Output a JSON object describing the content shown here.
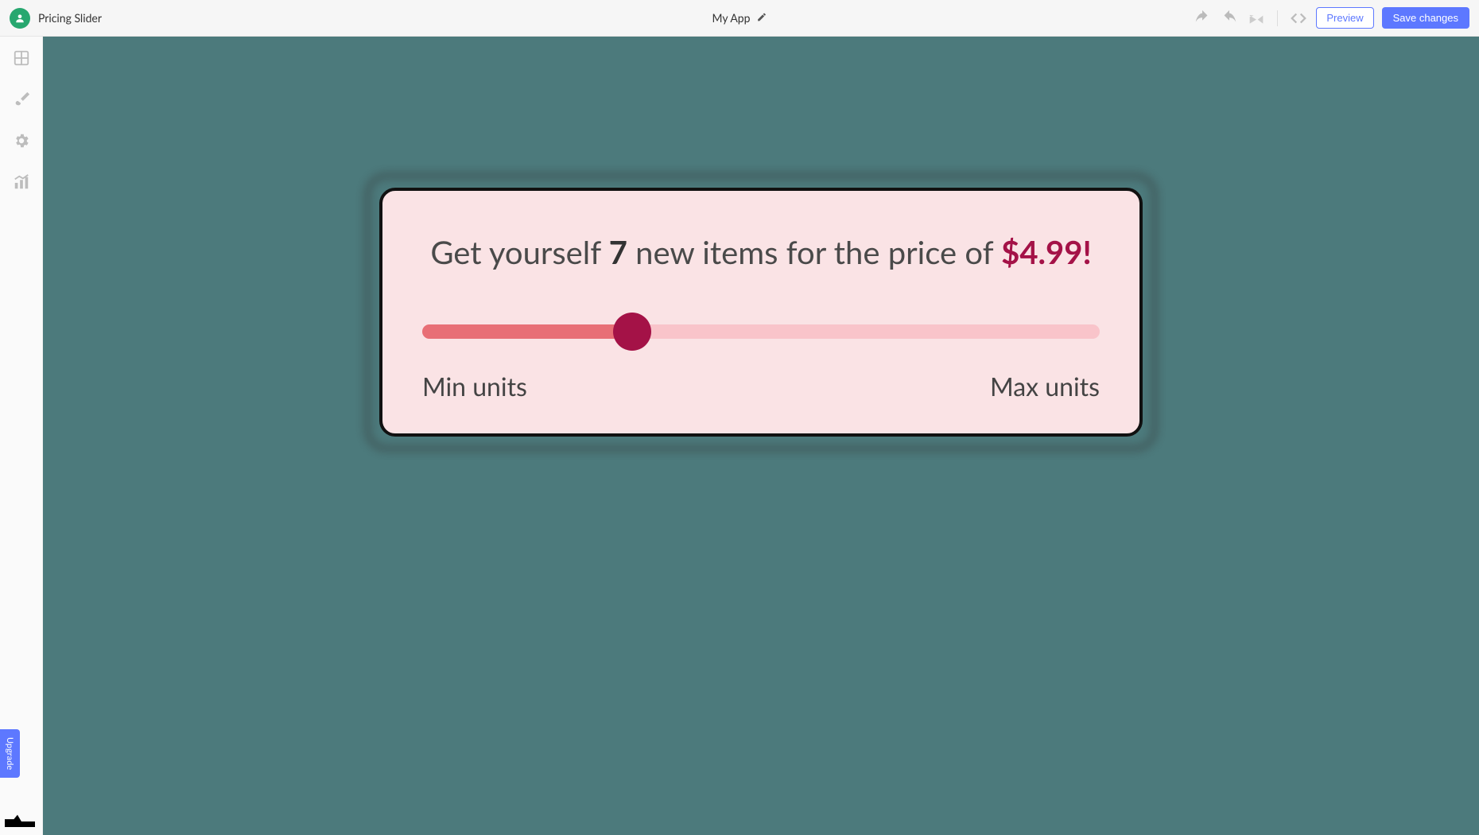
{
  "header": {
    "project_name": "Pricing Slider",
    "app_name": "My App",
    "preview_label": "Preview",
    "save_label": "Save changes"
  },
  "sidebar": {
    "upgrade_label": "Upgrade"
  },
  "card": {
    "headline_before": "Get yourself ",
    "item_count": "7",
    "headline_mid": " new items for the price of ",
    "price": "$4.99!",
    "min_label": "Min units",
    "max_label": "Max units",
    "slider_percent": 31
  }
}
